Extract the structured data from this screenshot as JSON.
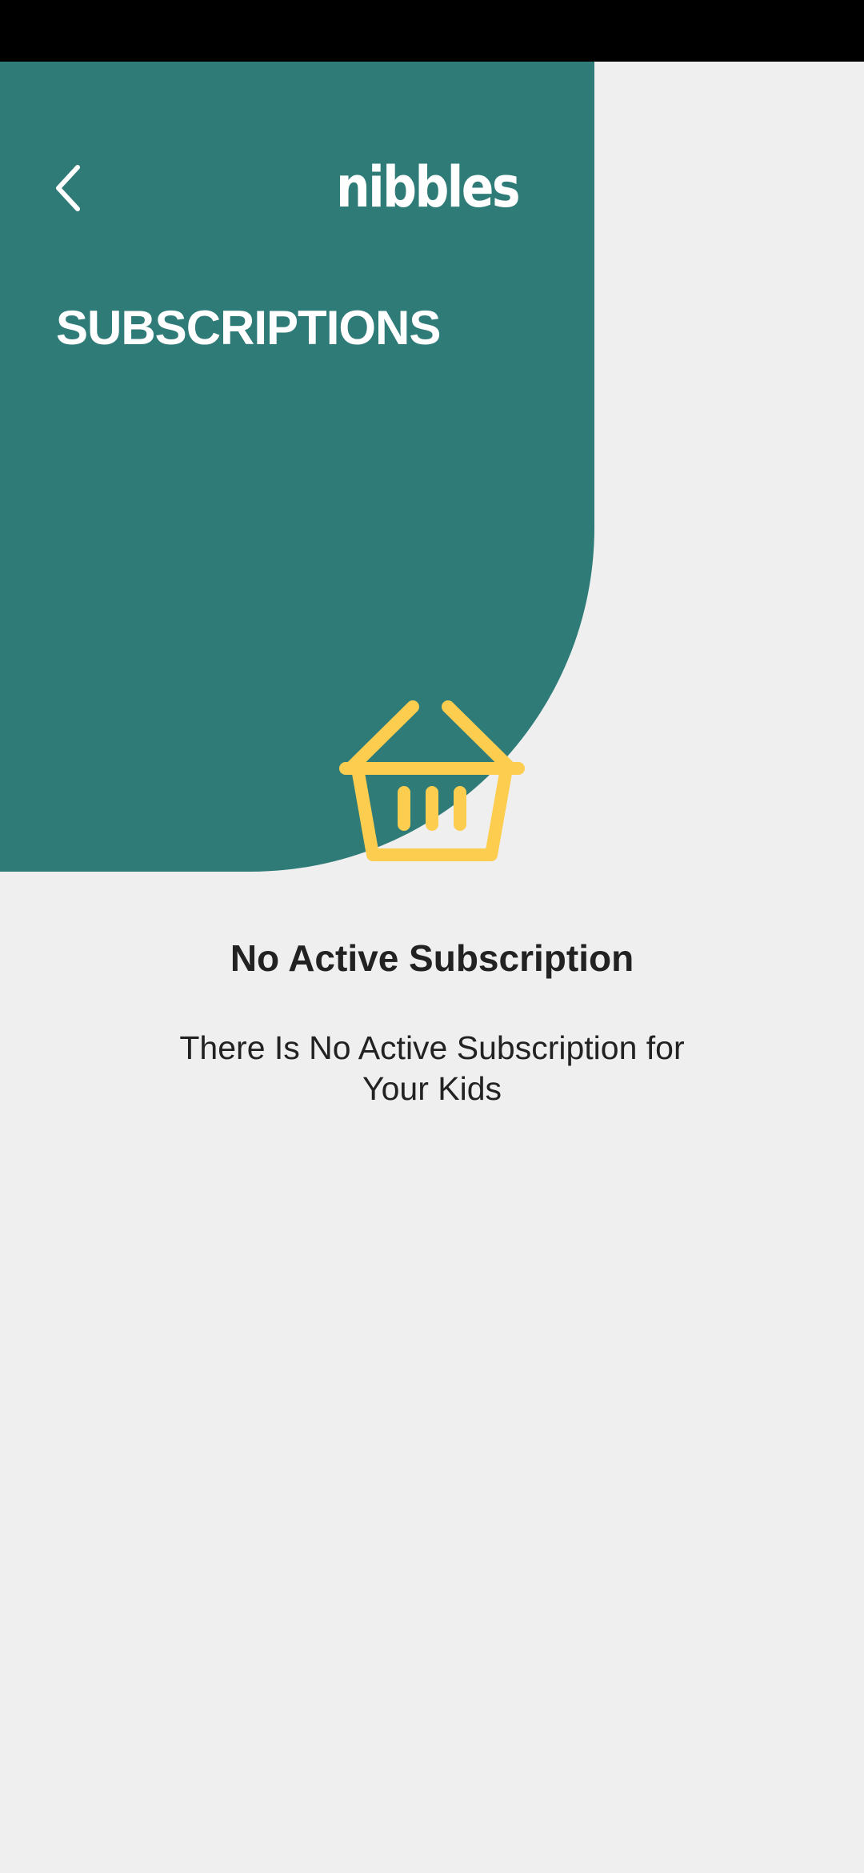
{
  "app": {
    "brand_name": "nibbles"
  },
  "header": {
    "back_icon": "chevron-left-icon",
    "title": "SUBSCRIPTIONS"
  },
  "empty_state": {
    "icon": "shopping-basket-icon",
    "title": "No Active Subscription",
    "message": "There Is No Active Subscription for Your Kids"
  },
  "colors": {
    "header_teal": "#2f7b78",
    "accent_yellow": "#fdcd50",
    "background": "#efefef",
    "text_dark": "#222222",
    "status_bar": "#000000"
  }
}
